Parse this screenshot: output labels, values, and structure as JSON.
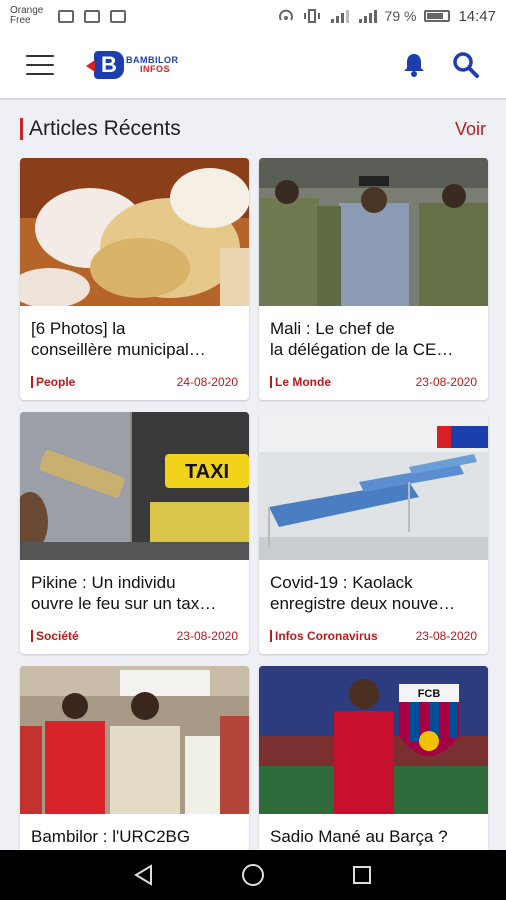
{
  "statusbar": {
    "carrier_line1": "Orange",
    "carrier_line2": "Free",
    "battery": "79 %",
    "time": "14:47"
  },
  "appbar": {
    "logo_line1": "BAMBILOR",
    "logo_line2": "INFOS",
    "menu_icon": "hamburger-icon",
    "notification_icon": "bell-icon",
    "search_icon": "search-icon",
    "accent_color": "#1d3fae"
  },
  "section": {
    "title": "Articles Récents",
    "link": "Voir"
  },
  "articles": [
    {
      "title_line1": "[6 Photos] la",
      "title_line2": "conseillère municipal…",
      "category": "People",
      "date": "24-08-2020"
    },
    {
      "title_line1": "Mali : Le chef de",
      "title_line2": "la délégation de la CE…",
      "category": "Le Monde",
      "date": "23-08-2020"
    },
    {
      "title_line1": "Pikine : Un individu",
      "title_line2": "ouvre le feu sur un tax…",
      "category": "Société",
      "date": "23-08-2020"
    },
    {
      "title_line1": "Covid-19 : Kaolack",
      "title_line2": "enregistre deux nouve…",
      "category": "Infos Coronavirus",
      "date": "23-08-2020"
    },
    {
      "title_line1": "Bambilor : l'URC2BG",
      "title_line2": "",
      "category": "",
      "date": ""
    },
    {
      "title_line1": "Sadio Mané au Barça ?",
      "title_line2": "",
      "category": "",
      "date": ""
    }
  ],
  "photo_text": {
    "taxi_sign": "TAXI",
    "crest_letters": "FCB"
  },
  "colors": {
    "category_red": "#b71c1c",
    "background": "#eef0f5"
  }
}
